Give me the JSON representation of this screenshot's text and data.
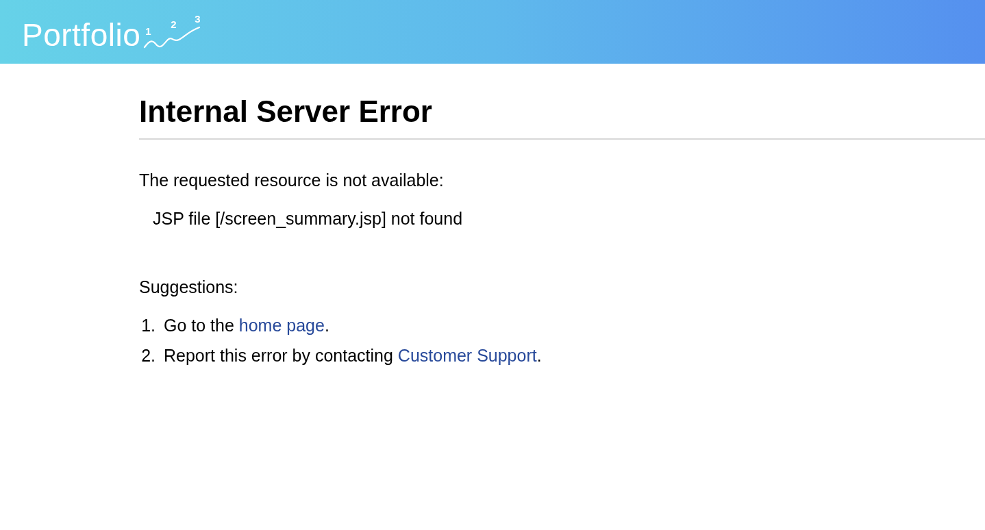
{
  "header": {
    "logo": {
      "text": "Portfolio",
      "marks": [
        "1",
        "2",
        "3"
      ]
    }
  },
  "error": {
    "title": "Internal Server Error",
    "message": "The requested resource is not available:",
    "detail": "JSP file [/screen_summary.jsp] not found"
  },
  "suggestions": {
    "heading": "Suggestions:",
    "items": [
      {
        "number": "1.",
        "text_before": "Go to the ",
        "link": "home page",
        "text_after": "."
      },
      {
        "number": "2.",
        "text_before": "Report this error by contacting ",
        "link": "Customer Support",
        "text_after": "."
      }
    ]
  }
}
